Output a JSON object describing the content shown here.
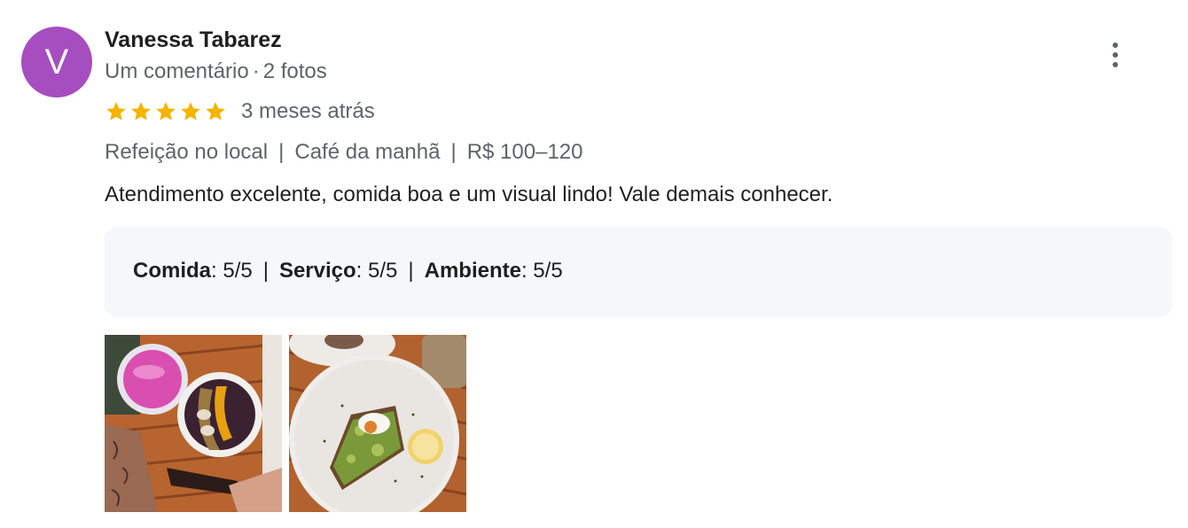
{
  "reviewer": {
    "initial": "V",
    "name": "Vanessa Tabarez",
    "comments": "Um comentário",
    "separator": "·",
    "photos": "2 fotos",
    "avatar_color": "#a64dc0"
  },
  "review": {
    "stars": 5,
    "star_color": "#f4b400",
    "date": "3 meses atrás",
    "tags": [
      "Refeição no local",
      "Café da manhã",
      "R$ 100–120"
    ],
    "tag_separator": "|",
    "text": "Atendimento excelente, comida boa e um visual lindo! Vale demais conhecer."
  },
  "scores": {
    "items": [
      {
        "label": "Comida",
        "value": ": 5/5"
      },
      {
        "label": "Serviço",
        "value": ": 5/5"
      },
      {
        "label": "Ambiente",
        "value": ": 5/5"
      }
    ],
    "separator": "|"
  },
  "photos": [
    {
      "icon": "acai-bowl-photo"
    },
    {
      "icon": "avocado-toast-photo"
    }
  ],
  "menu_icon": "more-vert-icon"
}
